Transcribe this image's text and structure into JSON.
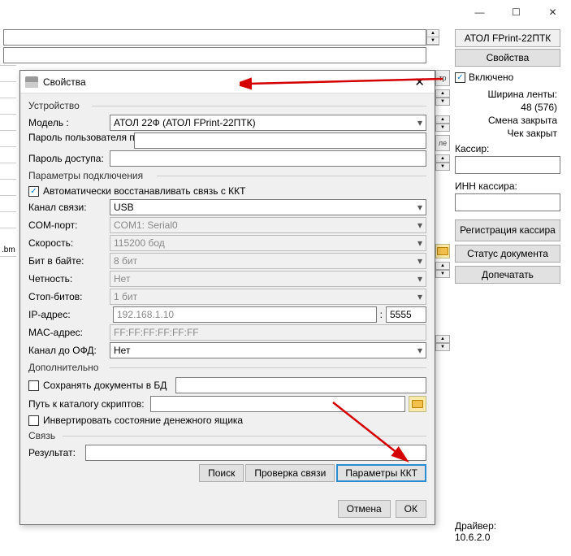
{
  "window": {
    "min": "—",
    "max": "☐",
    "close": "✕"
  },
  "right": {
    "title": "АТОЛ FPrint-22ПТК",
    "props_btn": "Свойства",
    "enabled_label": "Включено",
    "tape_l1": "Ширина ленты:",
    "tape_l2": "48 (576)",
    "shift": "Смена закрыта",
    "check": "Чек закрыт",
    "cashier": "Кассир:",
    "inn": "ИНН кассира:",
    "reg_btn": "Регистрация кассира",
    "status_btn": "Статус документа",
    "reprint_btn": "Допечатать",
    "drv_l1": "Драйвер:",
    "drv_l2": "10.6.2.0"
  },
  "left": {
    "bm": ".bm"
  },
  "dialog": {
    "title": "Свойства",
    "device_group": "Устройство",
    "model_lbl": "Модель :",
    "model_val": "АТОЛ 22Ф (АТОЛ FPrint-22ПТК)",
    "pwuser_lbl": "Пароль пользователя по умолчанию:",
    "pwacc_lbl": "Пароль доступа:",
    "conn_group": "Параметры подключения",
    "auto_label": "Автоматически восстанавливать связь с ККТ",
    "chan_lbl": "Канал связи:",
    "chan_val": "USB",
    "com_lbl": "COM-порт:",
    "com_val": "COM1: Serial0",
    "speed_lbl": "Скорость:",
    "speed_val": "115200 бод",
    "bit_lbl": "Бит в байте:",
    "bit_val": "8 бит",
    "parity_lbl": "Четность:",
    "parity_val": "Нет",
    "stop_lbl": "Стоп-битов:",
    "stop_val": "1 бит",
    "ip_lbl": "IP-адрес:",
    "ip_val": "192.168.1.10",
    "port_val": "5555",
    "mac_lbl": "MAC-адрес:",
    "mac_val": "FF:FF:FF:FF:FF:FF",
    "ofd_lbl": "Канал до ОФД:",
    "ofd_val": "Нет",
    "add_group": "Дополнительно",
    "savedb_label": "Сохранять документы в БД",
    "script_lbl": "Путь к каталогу скриптов:",
    "invert_label": "Инвертировать состояние денежного ящика",
    "link_group": "Связь",
    "result_lbl": "Результат:",
    "search_btn": "Поиск",
    "check_btn": "Проверка связи",
    "params_btn": "Параметры ККТ",
    "cancel_btn": "Отмена",
    "ok_btn": "ОК"
  },
  "side": {
    "tr": "тр",
    "le": "ле"
  }
}
